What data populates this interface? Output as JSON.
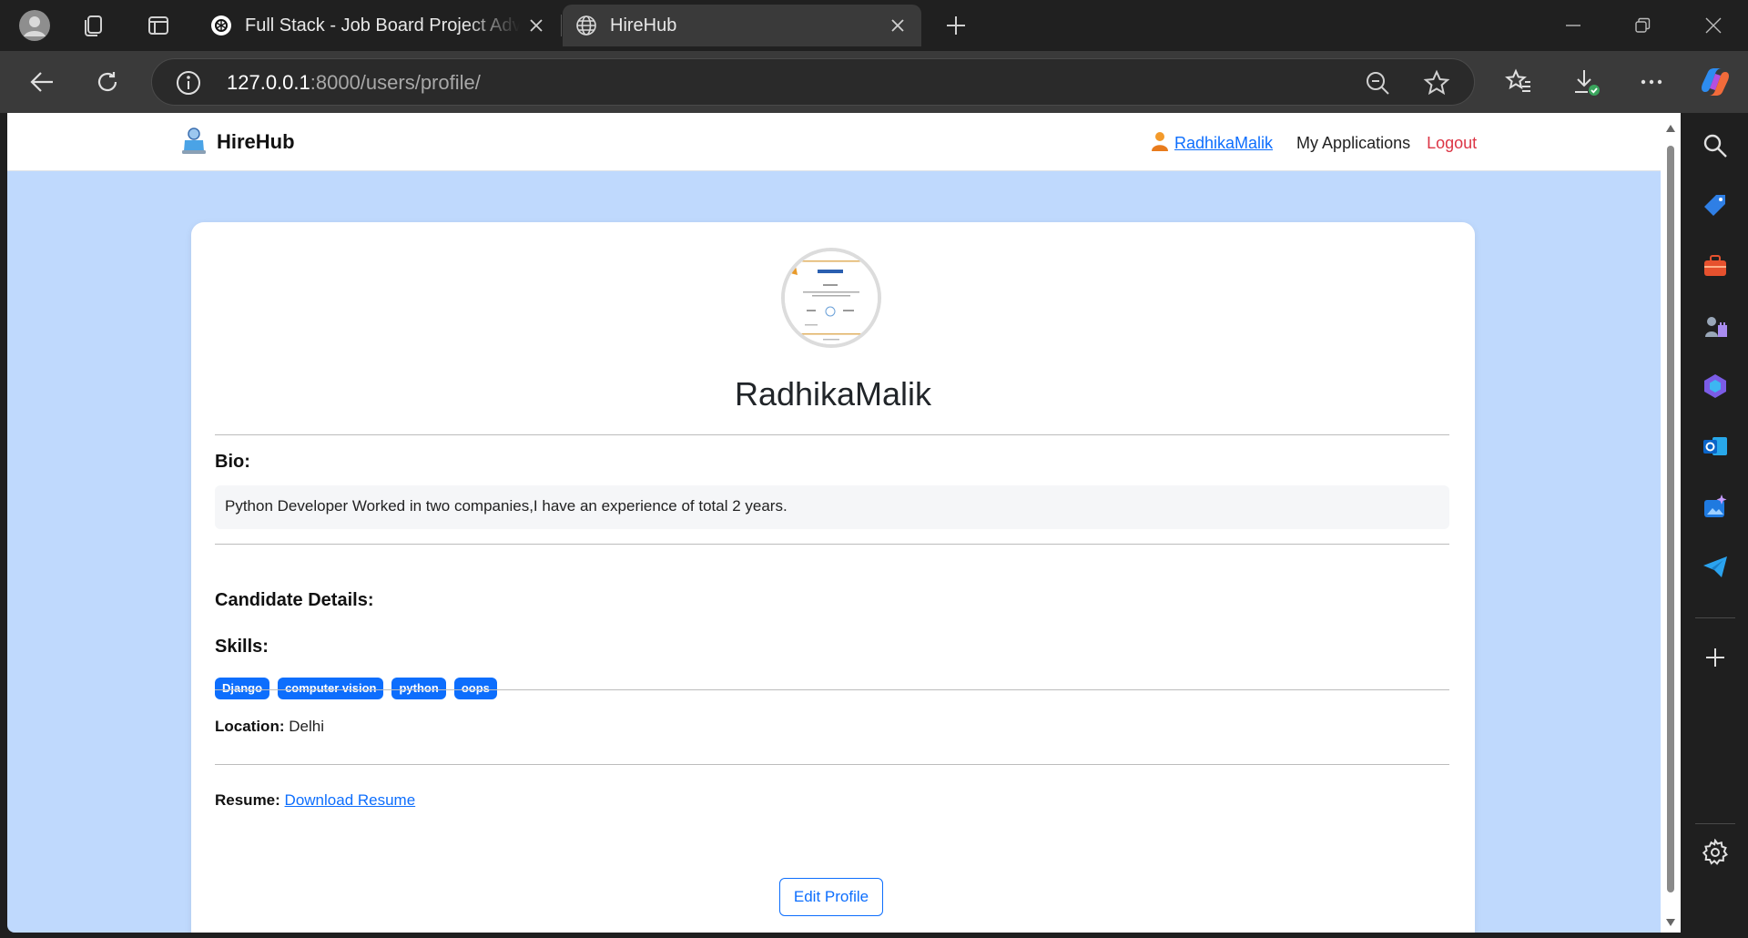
{
  "browser": {
    "tabs": [
      {
        "title": "Full Stack - Job Board Project Advanced Features",
        "favicon": "chatgpt-icon",
        "active": false
      },
      {
        "title": "HireHub",
        "favicon": "globe-icon",
        "active": true
      }
    ],
    "url_host": "127.0.0.1",
    "url_rest": ":8000/users/profile/"
  },
  "site": {
    "brand": "HireHub",
    "nav": {
      "username": "RadhikaMalik",
      "applications": "My Applications",
      "logout": "Logout"
    }
  },
  "profile": {
    "name": "RadhikaMalik",
    "bio_label": "Bio:",
    "bio": "Python Developer Worked in two companies,I have an experience of total 2 years.",
    "details_label": "Candidate Details:",
    "skills_label": "Skills:",
    "skills": [
      "Django",
      "computer vision",
      "python",
      "oops"
    ],
    "location_label": "Location:",
    "location": "Delhi",
    "resume_label": "Resume:",
    "resume_link": "Download Resume",
    "edit_button": "Edit Profile"
  },
  "colors": {
    "page_bg": "#bfd9fd",
    "primary": "#0d6efd",
    "danger": "#dc3545",
    "chrome_dark": "#202020"
  }
}
